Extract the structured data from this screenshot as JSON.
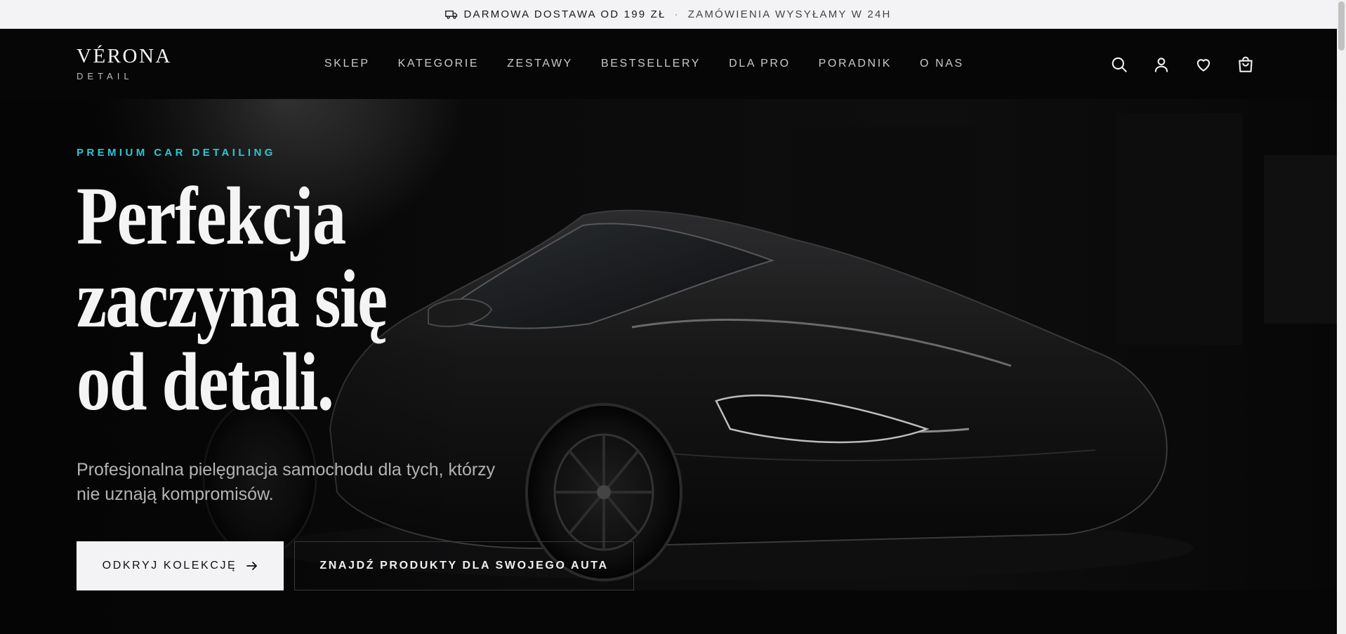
{
  "announcement": {
    "shipping": "DARMOWA DOSTAWA OD 199 ZŁ",
    "separator": "·",
    "dispatch": "ZAMÓWIENIA WYSYŁAMY W 24H",
    "icon": "truck-icon"
  },
  "brand": {
    "name": "VÉRONA",
    "sub": "DETAIL"
  },
  "nav": {
    "items": [
      {
        "label": "SKLEP"
      },
      {
        "label": "KATEGORIE"
      },
      {
        "label": "ZESTAWY"
      },
      {
        "label": "BESTSELLERY"
      },
      {
        "label": "DLA PRO"
      },
      {
        "label": "PORADNIK"
      },
      {
        "label": "O NAS"
      }
    ]
  },
  "header_icons": [
    "search-icon",
    "user-icon",
    "heart-icon",
    "bag-icon"
  ],
  "hero": {
    "eyebrow": "PREMIUM CAR DETAILING",
    "headline": {
      "line1": "Perfekcja",
      "line2": "zaczyna się",
      "line3": "od detali."
    },
    "subtext": "Profesjonalna pielęgnacja samochodu dla tych, którzy nie uznają kompromisów.",
    "cta_primary": "ODKRYJ KOLEKCJĘ",
    "cta_secondary": "ZNAJDŹ PRODUKTY DLA SWOJEGO AUTA"
  },
  "colors": {
    "accent": "#27c8d4",
    "background": "#050505",
    "topbar": "#f3f3f5"
  }
}
